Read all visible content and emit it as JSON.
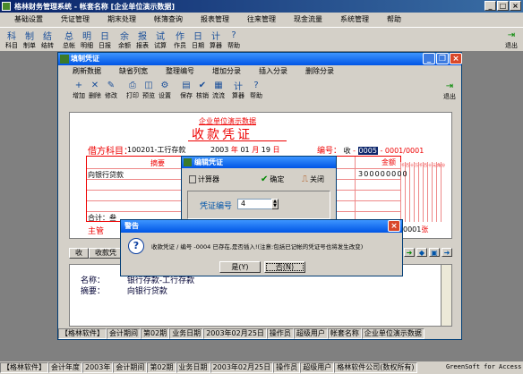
{
  "app": {
    "title": "格林财务管理系统 - 帐套名称 [企业单位演示数据]",
    "menus": [
      "基础设置",
      "凭证管理",
      "期末处理",
      "帐簿查询",
      "报表管理",
      "往来管理",
      "现金流量",
      "系统管理",
      "帮助"
    ],
    "toolbar": [
      {
        "icon": "科",
        "label": "科目"
      },
      {
        "icon": "制",
        "label": "制单"
      },
      {
        "icon": "结",
        "label": "结转"
      },
      {
        "icon": "总",
        "label": "总帐"
      },
      {
        "icon": "明",
        "label": "明细"
      },
      {
        "icon": "日",
        "label": "日报"
      },
      {
        "icon": "余",
        "label": "余额"
      },
      {
        "icon": "报",
        "label": "报表"
      },
      {
        "icon": "试",
        "label": "试算"
      },
      {
        "icon": "作",
        "label": "作员"
      },
      {
        "icon": "日",
        "label": "日期"
      },
      {
        "icon": "计",
        "label": "算器"
      },
      {
        "icon": "?",
        "label": "帮助"
      }
    ],
    "exit_label": "退出"
  },
  "voucher_window": {
    "title": "填制凭证",
    "menus": [
      "刷新数据",
      "缺省列宽",
      "整理编号",
      "增加分录",
      "插入分录",
      "删除分录"
    ],
    "toolbar": [
      {
        "icon": "+",
        "label": "增加"
      },
      {
        "icon": "✕",
        "label": "删除"
      },
      {
        "icon": "✎",
        "label": "修改"
      },
      {
        "icon": "⎙",
        "label": "打印"
      },
      {
        "icon": "◫",
        "label": "预览"
      },
      {
        "icon": "⚙",
        "label": "设置"
      },
      {
        "icon": "▤",
        "label": "保存"
      },
      {
        "icon": "✔",
        "label": "核销"
      },
      {
        "icon": "▦",
        "label": "流流"
      },
      {
        "icon": "计",
        "label": "算器"
      },
      {
        "icon": "?",
        "label": "帮助"
      }
    ],
    "exit_label": "退出",
    "company": "企业单位演示数据",
    "voucher_title": "收款凭证",
    "debit_subject_label": "借方科目：",
    "debit_subject": "100201-工行存款",
    "date_year": "2003",
    "date_month": "01",
    "date_day": "19",
    "date_y_label": "年",
    "date_m_label": "月",
    "date_d_label": "日",
    "number_label": "编号：",
    "number_type": "收",
    "number_current": "0005",
    "number_total": "- 0001/0001",
    "summary_header": "摘要",
    "amount_header": "金额",
    "digit_headers": [
      "千",
      "百",
      "十",
      "万",
      "千",
      "百",
      "十",
      "元",
      "角",
      "分"
    ],
    "row1_summary": "向银行贷款",
    "row1_amount": "300000000",
    "total_label": "合计：",
    "total_value": "叁",
    "supervisor_label": "主管",
    "attach_count": "0001",
    "attach_unit": "张",
    "bottom_tabs": [
      "收",
      "收款凭"
    ],
    "name_label": "名称：",
    "name_value": "银行存款-工行存款",
    "summary_label": "摘要：",
    "summary_value": "向银行贷款",
    "status": [
      "【格林软件】",
      "会计期间",
      "第02期",
      "业务日期",
      "2003年02月25日",
      "操作员",
      "超级用户",
      "帐套名称",
      "企业单位演示数据"
    ]
  },
  "edit_dialog": {
    "title": "编辑凭证",
    "calc_label": "计算器",
    "ok_label": "确定",
    "close_label": "关闭",
    "number_label": "凭证编号",
    "number_value": "4"
  },
  "warning": {
    "title": "警告",
    "message": "收款凭证 / 编号 -0004 已存在,是否插入!(注意:包括已记帐的凭证号也将发生改变)",
    "yes_label": "是(Y)",
    "no_label": "否(N)"
  },
  "main_status": [
    "【格林软件】",
    "会计年度",
    "2003年",
    "会计期间",
    "第02期",
    "业务日期",
    "2003年02月25日",
    "操作员",
    "超级用户",
    "格林软件公司(数权所有)"
  ],
  "brand": "GreenSoft for Access"
}
